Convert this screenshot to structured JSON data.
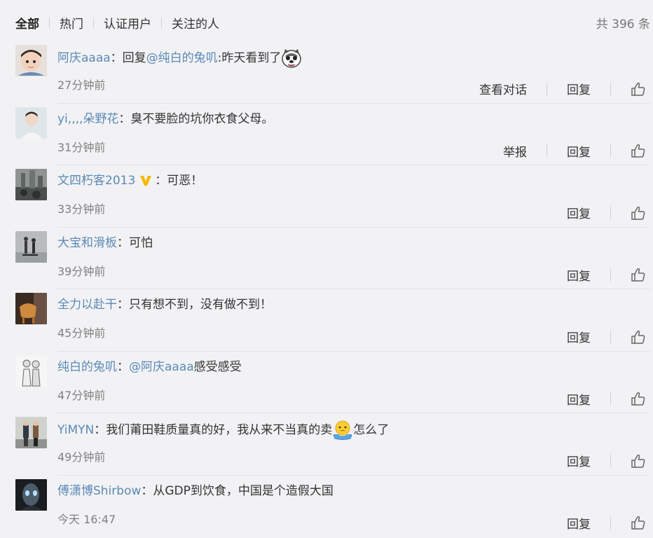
{
  "filters": [
    "全部",
    "热门",
    "认证用户",
    "关注的人"
  ],
  "total": "共 396 条",
  "comments": [
    {
      "user": "阿庆aaaa",
      "time": "27分钟前",
      "parts": [
        {
          "t": "text",
          "v": "回复"
        },
        {
          "t": "mention",
          "v": "@纯白的兔叽"
        },
        {
          "t": "text",
          "v": ":昨天看到了"
        }
      ],
      "emoji": "husky-sticker-icon",
      "actions": [
        "查看对话",
        "回复"
      ]
    },
    {
      "user": "yi,,,,朵野花",
      "time": "31分钟前",
      "parts": [
        {
          "t": "text",
          "v": "臭不要脸的坑你衣食父母。"
        }
      ],
      "actions": [
        "举报",
        "回复"
      ]
    },
    {
      "user": "文四朽客2013",
      "time": "33分钟前",
      "verified": true,
      "parts": [
        {
          "t": "text",
          "v": "可恶！"
        }
      ],
      "actions": [
        "回复"
      ]
    },
    {
      "user": "大宝和滑板",
      "time": "39分钟前",
      "parts": [
        {
          "t": "text",
          "v": "可怕"
        }
      ],
      "actions": [
        "回复"
      ]
    },
    {
      "user": "全力以赴干",
      "time": "45分钟前",
      "parts": [
        {
          "t": "text",
          "v": "只有想不到，没有做不到！"
        }
      ],
      "actions": [
        "回复"
      ]
    },
    {
      "user": "纯白的兔叽",
      "time": "47分钟前",
      "parts": [
        {
          "t": "mention",
          "v": "@阿庆aaaa"
        },
        {
          "t": "text",
          "v": " 感受感受"
        }
      ],
      "actions": [
        "回复"
      ]
    },
    {
      "user": "YiMYN",
      "time": "49分钟前",
      "parts": [
        {
          "t": "text",
          "v": "我们莆田鞋质量真的好，我从来不当真的卖"
        },
        {
          "t": "emoji",
          "v": "shrug-emoji-icon"
        },
        {
          "t": "text",
          "v": "怎么了"
        }
      ],
      "actions": [
        "回复"
      ]
    },
    {
      "user": "傅潇博Shirbow",
      "time": "今天 16:47",
      "parts": [
        {
          "t": "text",
          "v": "从GDP到饮食，中国是个造假大国"
        }
      ],
      "actions": [
        "回复"
      ]
    }
  ],
  "colors": {
    "link": "#5b89b5",
    "text": "#333333",
    "muted": "#808080",
    "background": "#f2f2f5"
  }
}
